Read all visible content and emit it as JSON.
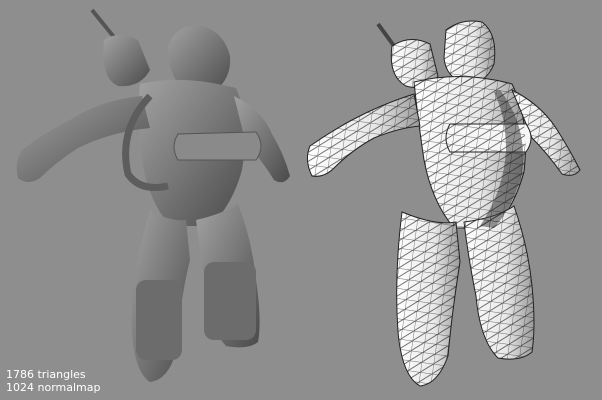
{
  "caption": {
    "triangles": "1786 triangles",
    "normalmap": "1024 normalmap"
  },
  "colors": {
    "background": "#8e8e8e",
    "shaded_body": "#6f6f6f",
    "shaded_highlight": "#9c9c9c",
    "wire_fill": "#f2f2f2",
    "wire_shadow": "#3f3f3f",
    "wire_line": "#1e1e1e"
  }
}
